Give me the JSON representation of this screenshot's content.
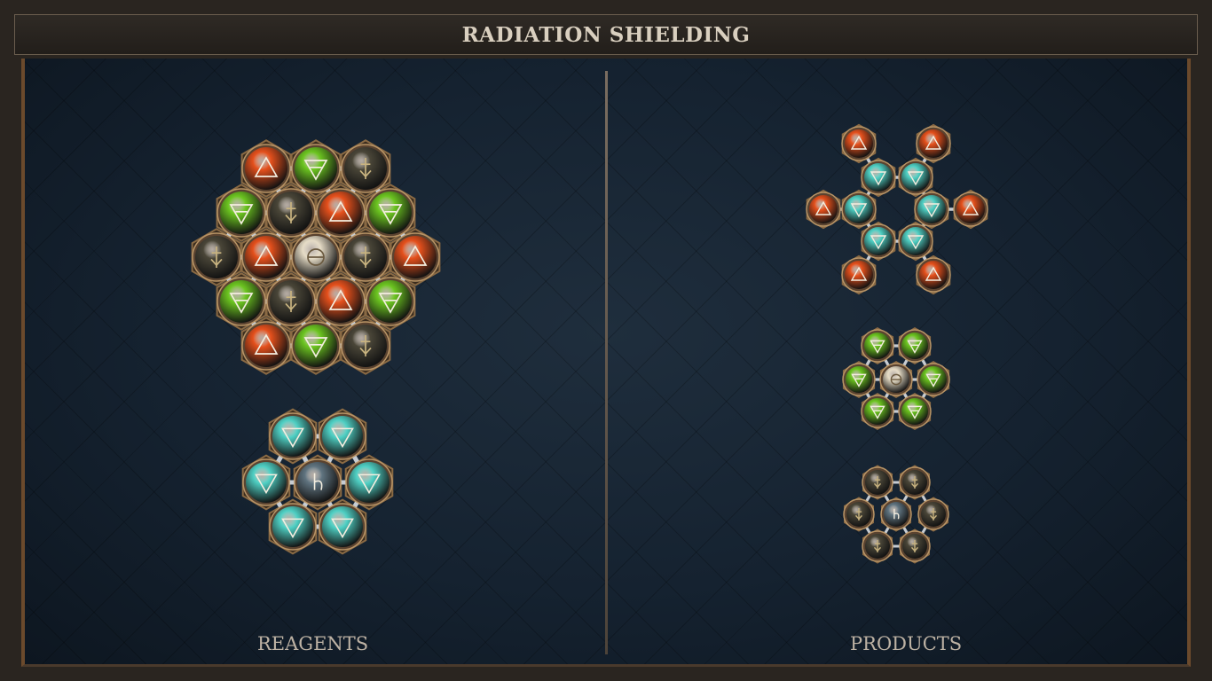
{
  "title": "RADIATION SHIELDING",
  "reagents_label": "REAGENTS",
  "products_label": "PRODUCTS",
  "element_types": {
    "fire": {
      "symbol": "fire-triangle-icon",
      "color": "#e5501c"
    },
    "earth": {
      "symbol": "earth-triangle-icon",
      "color": "#6cc520"
    },
    "water": {
      "symbol": "water-triangle-icon",
      "color": "#4fd0c4"
    },
    "lead": {
      "symbol": "lead-icon",
      "color": "#4a4638"
    },
    "salt": {
      "symbol": "salt-icon",
      "color": "#e6dcc6"
    },
    "quintessence": {
      "symbol": "quintessence-icon",
      "color": "#607480"
    }
  },
  "reagents": [
    {
      "name": "reagent-1",
      "atoms": [
        "fire",
        "earth",
        "lead",
        "earth",
        "lead",
        "fire",
        "earth",
        "lead",
        "fire",
        "salt",
        "lead",
        "fire",
        "earth",
        "lead",
        "fire",
        "earth",
        "fire",
        "earth",
        "lead"
      ]
    },
    {
      "name": "reagent-2",
      "atoms": [
        "water",
        "water",
        "water",
        "quintessence",
        "water",
        "water",
        "water"
      ]
    }
  ],
  "products": [
    {
      "name": "product-1",
      "atoms": [
        "fire",
        "fire",
        "water",
        "water",
        "fire",
        "water",
        "water",
        "fire",
        "water",
        "water",
        "fire",
        "fire"
      ]
    },
    {
      "name": "product-2",
      "atoms": [
        "earth",
        "earth",
        "earth",
        "salt",
        "earth",
        "earth",
        "earth"
      ]
    },
    {
      "name": "product-3",
      "atoms": [
        "lead",
        "lead",
        "lead",
        "quintessence",
        "lead",
        "lead",
        "lead"
      ]
    }
  ]
}
